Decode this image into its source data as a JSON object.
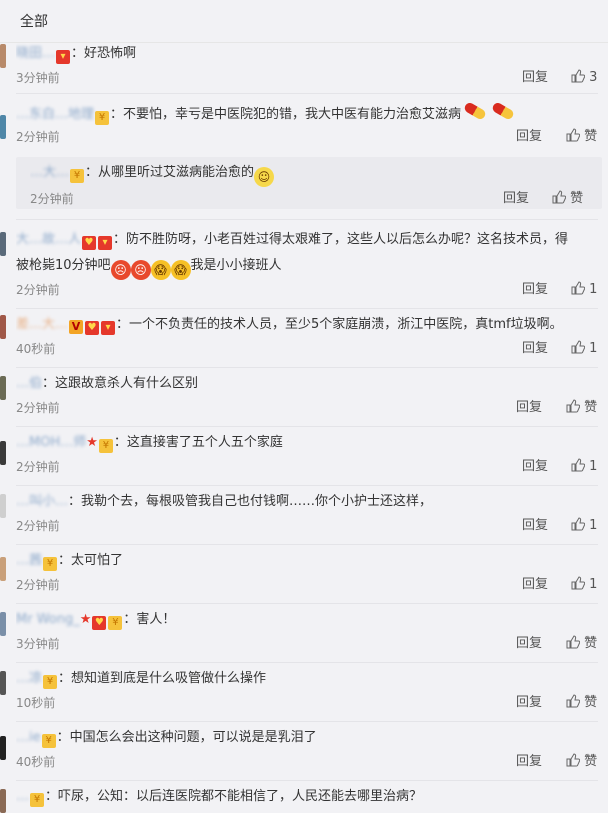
{
  "header": {
    "title": "全部"
  },
  "comments": [
    {
      "name": "晓田…",
      "badges": [
        "red"
      ],
      "text": "：好恐怖啊",
      "time": "3分钟前",
      "reply": "回复",
      "like": "3"
    },
    {
      "name": "…东白…地理",
      "badges": [
        "gold"
      ],
      "text": "：不要怕，幸亏是中医院犯的错，我大中医有能力治愈艾滋病",
      "time": "2分钟前",
      "reply": "回复",
      "like": "赞"
    },
    {
      "name": "…大…",
      "badges": [
        "gold"
      ],
      "text": "：从哪里听过艾滋病能治愈的",
      "time": "2分钟前",
      "reply": "回复",
      "like": "赞",
      "nested": true
    },
    {
      "name": "大…故…人",
      "badges": [
        "gold",
        "red"
      ],
      "text": "：防不胜防呀，小老百姓过得太艰难了，这些人以后怎么办呢？这名技术员，得",
      "text2": "被枪毙10分钟吧",
      "text3": "我是小小接班人",
      "time": "2分钟前",
      "reply": "回复",
      "like": "1"
    },
    {
      "name": "差…大…",
      "badges": [
        "vip",
        "gold",
        "red"
      ],
      "text": "：一个不负责任的技术人员，至少5个家庭崩溃，浙江中医院，真tmf垃圾啊。",
      "time": "40秒前",
      "reply": "回复",
      "like": "1"
    },
    {
      "name": "…伯",
      "badges": [],
      "text": "：这跟故意杀人有什么区别",
      "time": "2分钟前",
      "reply": "回复",
      "like": "赞"
    },
    {
      "name": "…MOH…师",
      "badges": [
        "star",
        "gold"
      ],
      "text": "：这直接害了五个人五个家庭",
      "time": "2分钟前",
      "reply": "回复",
      "like": "1"
    },
    {
      "name": "…叫小…",
      "badges": [],
      "text": "：我勒个去，每根吸管我自己也付钱啊……你个小护士还这样，",
      "time": "2分钟前",
      "reply": "回复",
      "like": "1"
    },
    {
      "name": "…茜",
      "badges": [
        "gold"
      ],
      "text": "：太可怕了",
      "time": "2分钟前",
      "reply": "回复",
      "like": "1"
    },
    {
      "name": "Mr Wong_",
      "badges": [
        "star",
        "gold",
        "gold"
      ],
      "text": "：害人！",
      "time": "3分钟前",
      "reply": "回复",
      "like": "赞"
    },
    {
      "name": "…凉",
      "badges": [
        "gold"
      ],
      "text": "：想知道到底是什么吸管做什么操作",
      "time": "10秒前",
      "reply": "回复",
      "like": "赞"
    },
    {
      "name": "…ie",
      "badges": [
        "gold"
      ],
      "text": "：中国怎么会出这种问题，可以说是是乳泪了",
      "time": "40秒前",
      "reply": "回复",
      "like": "赞"
    },
    {
      "name": "…",
      "badges": [
        "gold"
      ],
      "text": "：吓尿，公知：以后连医院都不能相信了，人民还能去哪里治病？",
      "time": "",
      "reply": "",
      "like": ""
    }
  ]
}
